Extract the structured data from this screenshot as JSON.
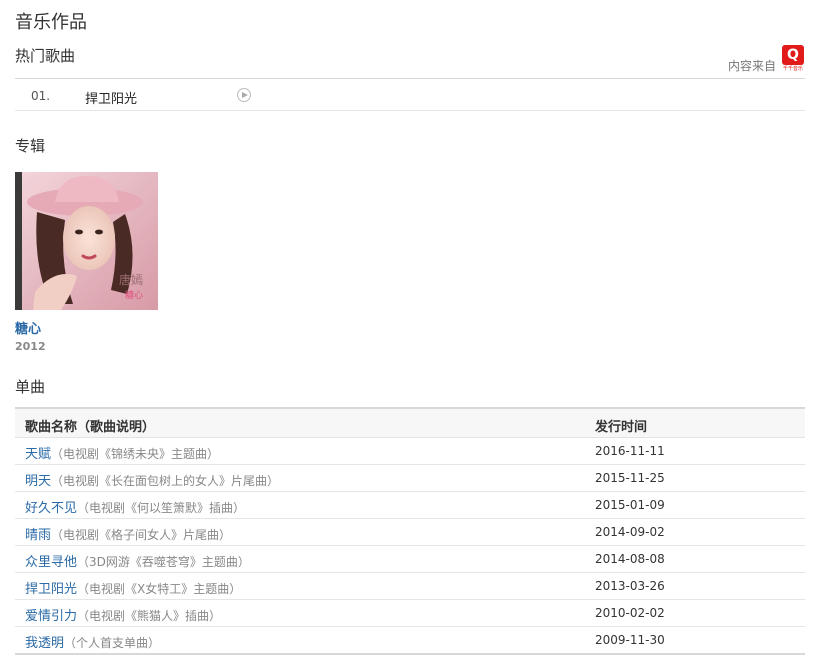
{
  "page_title": "音乐作品",
  "hot_songs": {
    "heading": "热门歌曲",
    "source_label": "内容来自",
    "source_logo_caption": "千千音乐",
    "items": [
      {
        "number": "01.",
        "name": "捍卫阳光"
      }
    ]
  },
  "albums": {
    "heading": "专辑",
    "items": [
      {
        "title": "糖心",
        "year": "2012",
        "cover_text": "唐嫣"
      }
    ]
  },
  "singles": {
    "heading": "单曲",
    "col_name": "歌曲名称（歌曲说明）",
    "col_date": "发行时间",
    "rows": [
      {
        "name": "天赋",
        "desc": "（电视剧《锦绣未央》主题曲）",
        "date": "2016-11-11"
      },
      {
        "name": "明天",
        "desc": "（电视剧《长在面包树上的女人》片尾曲）",
        "date": "2015-11-25"
      },
      {
        "name": "好久不见",
        "desc": "（电视剧《何以笙箫默》插曲）",
        "date": "2015-01-09"
      },
      {
        "name": "晴雨",
        "desc": "（电视剧《格子间女人》片尾曲）",
        "date": "2014-09-02"
      },
      {
        "name": "众里寻他",
        "desc": "（3D网游《吞噬苍穹》主题曲）",
        "date": "2014-08-08"
      },
      {
        "name": "捍卫阳光",
        "desc": "（电视剧《X女特工》主题曲）",
        "date": "2013-03-26"
      },
      {
        "name": "爱情引力",
        "desc": "（电视剧《熊猫人》插曲）",
        "date": "2010-02-02"
      },
      {
        "name": "我透明",
        "desc": "（个人首支单曲）",
        "date": "2009-11-30"
      }
    ]
  },
  "colors": {
    "link": "#2a6aa6",
    "brand_red": "#e11a1a",
    "cover_pink": "#e7b9c1"
  }
}
